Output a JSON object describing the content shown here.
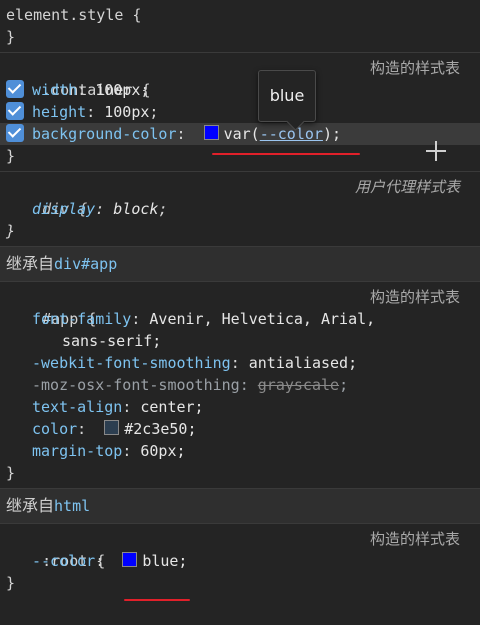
{
  "element_style": {
    "selector": "element.style {",
    "close": "}"
  },
  "container_rule": {
    "selector": ".container {",
    "origin": "构造的样式表",
    "props": [
      {
        "name": "width",
        "value": "100px"
      },
      {
        "name": "height",
        "value": "100px"
      },
      {
        "name": "background-color",
        "func": "var(",
        "var_name": "--color",
        "tail": ");"
      }
    ],
    "swatch_color": "#0000ff",
    "close": "}"
  },
  "tooltip": {
    "text": "blue"
  },
  "div_rule": {
    "selector": "div {",
    "origin": "用户代理样式表",
    "prop": {
      "name": "display",
      "value": "block"
    },
    "close": "}"
  },
  "inherit_app": {
    "label": "继承自",
    "source": "div#app"
  },
  "app_rule": {
    "selector": "#app {",
    "origin": "构造的样式表",
    "font_family": {
      "name": "font-family",
      "value1": "Avenir, Helvetica, Arial,",
      "value2": "sans-serif;"
    },
    "webkit": {
      "name": "-webkit-font-smoothing",
      "value": "antialiased;"
    },
    "moz": {
      "name": "-moz-osx-font-smoothing",
      "value": "grayscale",
      "tail": ";"
    },
    "text_align": {
      "name": "text-align",
      "value": "center;"
    },
    "color": {
      "name": "color",
      "value": "#2c3e50;",
      "swatch": "#2c3e50"
    },
    "margin_top": {
      "name": "margin-top",
      "value": "60px;"
    },
    "close": "}"
  },
  "inherit_html": {
    "label": "继承自",
    "source": "html"
  },
  "root_rule": {
    "selector": ":root {",
    "origin": "构造的样式表",
    "prop": {
      "name": "--color",
      "value": "blue;",
      "swatch": "#0000ff"
    },
    "close": "}"
  }
}
